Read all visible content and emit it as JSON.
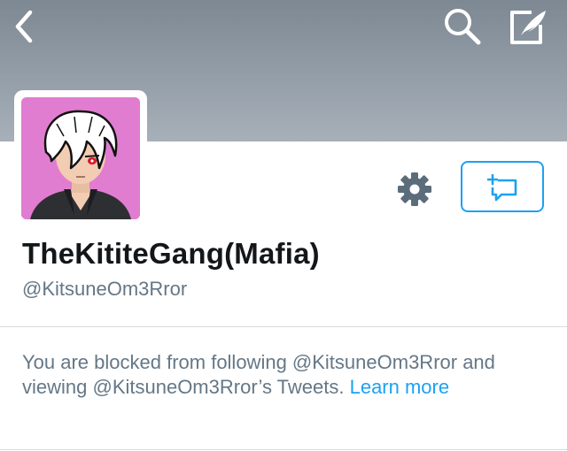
{
  "nav": {
    "back_icon": "chevron-left-icon",
    "search_icon": "search-icon",
    "compose_icon": "compose-tweet-icon"
  },
  "profile": {
    "display_name": "TheKititeGang(Mafia)",
    "handle": "@KitsuneOm3Rror",
    "avatar_description": "anime-avatar",
    "avatar_bg_color": "#e17dd0"
  },
  "actions": {
    "settings_icon": "gear-icon",
    "message_icon": "new-message-icon"
  },
  "blocked_notice": {
    "text_part1": "You are blocked from following @KitsuneOm3Rror and viewing @KitsuneOm3Rror’s Tweets. ",
    "link_text": "Learn more"
  },
  "colors": {
    "accent": "#1da1f2",
    "text_primary": "#14171a",
    "text_secondary": "#657786",
    "header_bg": "#8d97a1"
  }
}
